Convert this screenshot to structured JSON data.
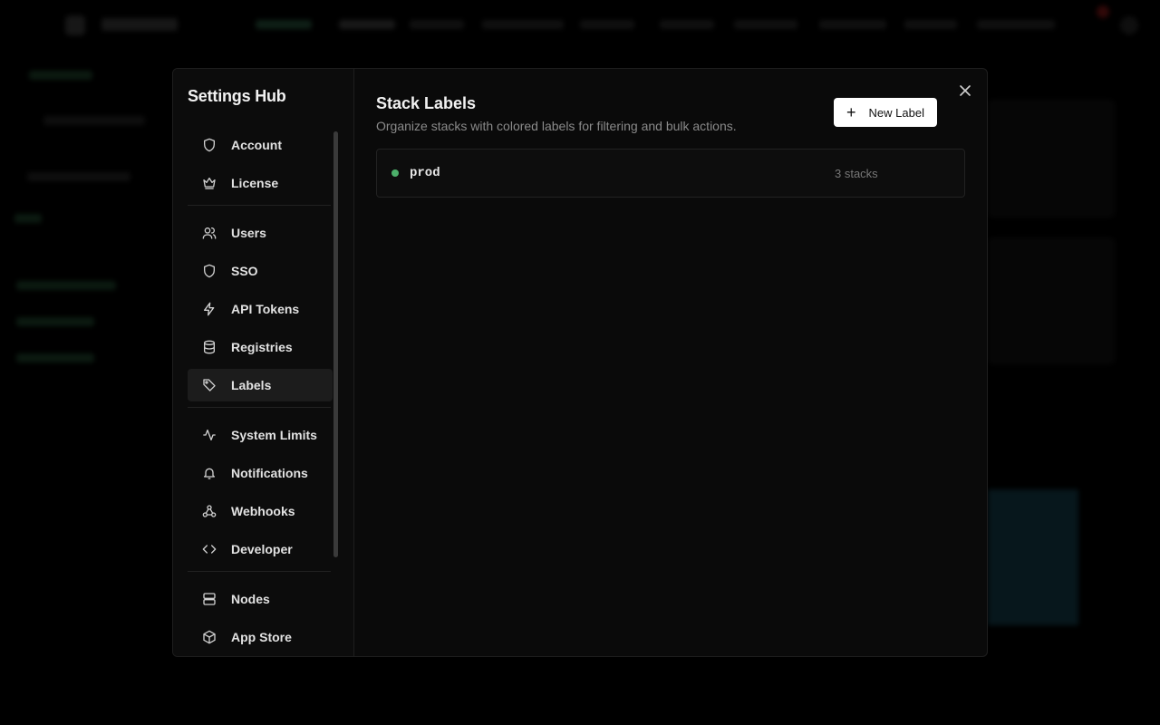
{
  "colors": {
    "overlay": "#000000",
    "modal_bg": "#0a0a0a",
    "accent_white": "#ffffff",
    "label_prod": "#4caf6a"
  },
  "hub": {
    "title": "Settings Hub",
    "nav": [
      {
        "label": "Account",
        "icon": "shield-icon"
      },
      {
        "label": "License",
        "icon": "crown-icon"
      },
      {
        "label": "Users",
        "icon": "users-icon"
      },
      {
        "label": "SSO",
        "icon": "shield-icon"
      },
      {
        "label": "API Tokens",
        "icon": "lightning-icon"
      },
      {
        "label": "Registries",
        "icon": "database-icon"
      },
      {
        "label": "Labels",
        "icon": "tag-icon",
        "active": true
      },
      {
        "label": "System Limits",
        "icon": "activity-icon"
      },
      {
        "label": "Notifications",
        "icon": "bell-icon"
      },
      {
        "label": "Webhooks",
        "icon": "webhook-icon"
      },
      {
        "label": "Developer",
        "icon": "code-icon"
      },
      {
        "label": "Nodes",
        "icon": "server-icon"
      },
      {
        "label": "App Store",
        "icon": "package-icon"
      }
    ]
  },
  "main": {
    "title": "Stack Labels",
    "subtitle": "Organize stacks with colored labels for filtering and bulk actions.",
    "new_label_button": "New Label",
    "close_icon": "close-icon",
    "labels": [
      {
        "name": "prod",
        "count": "3 stacks",
        "color": "#4caf6a"
      }
    ]
  }
}
